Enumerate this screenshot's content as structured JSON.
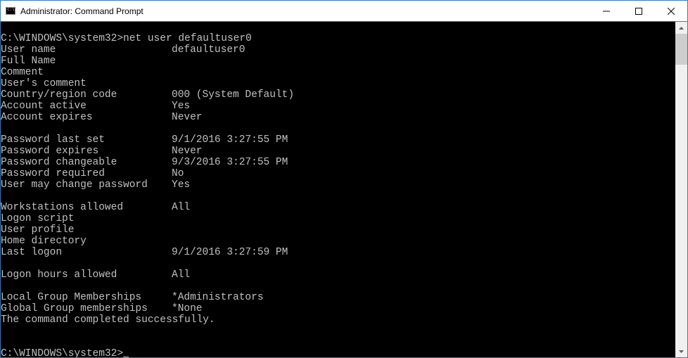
{
  "window": {
    "title": "Administrator: Command Prompt"
  },
  "terminal": {
    "prompt1": "C:\\WINDOWS\\system32>",
    "command1": "net user defaultuser0",
    "fields": [
      {
        "label": "User name",
        "value": "defaultuser0"
      },
      {
        "label": "Full Name",
        "value": ""
      },
      {
        "label": "Comment",
        "value": ""
      },
      {
        "label": "User's comment",
        "value": ""
      },
      {
        "label": "Country/region code",
        "value": "000 (System Default)"
      },
      {
        "label": "Account active",
        "value": "Yes"
      },
      {
        "label": "Account expires",
        "value": "Never"
      }
    ],
    "fields2": [
      {
        "label": "Password last set",
        "value": "9/1/2016 3:27:55 PM"
      },
      {
        "label": "Password expires",
        "value": "Never"
      },
      {
        "label": "Password changeable",
        "value": "9/3/2016 3:27:55 PM"
      },
      {
        "label": "Password required",
        "value": "No"
      },
      {
        "label": "User may change password",
        "value": "Yes"
      }
    ],
    "fields3": [
      {
        "label": "Workstations allowed",
        "value": "All"
      },
      {
        "label": "Logon script",
        "value": ""
      },
      {
        "label": "User profile",
        "value": ""
      },
      {
        "label": "Home directory",
        "value": ""
      },
      {
        "label": "Last logon",
        "value": "9/1/2016 3:27:59 PM"
      }
    ],
    "fields4": [
      {
        "label": "Logon hours allowed",
        "value": "All"
      }
    ],
    "fields5": [
      {
        "label": "Local Group Memberships",
        "value": "*Administrators"
      },
      {
        "label": "Global Group memberships",
        "value": "*None"
      }
    ],
    "completion": "The command completed successfully.",
    "prompt2": "C:\\WINDOWS\\system32>"
  }
}
